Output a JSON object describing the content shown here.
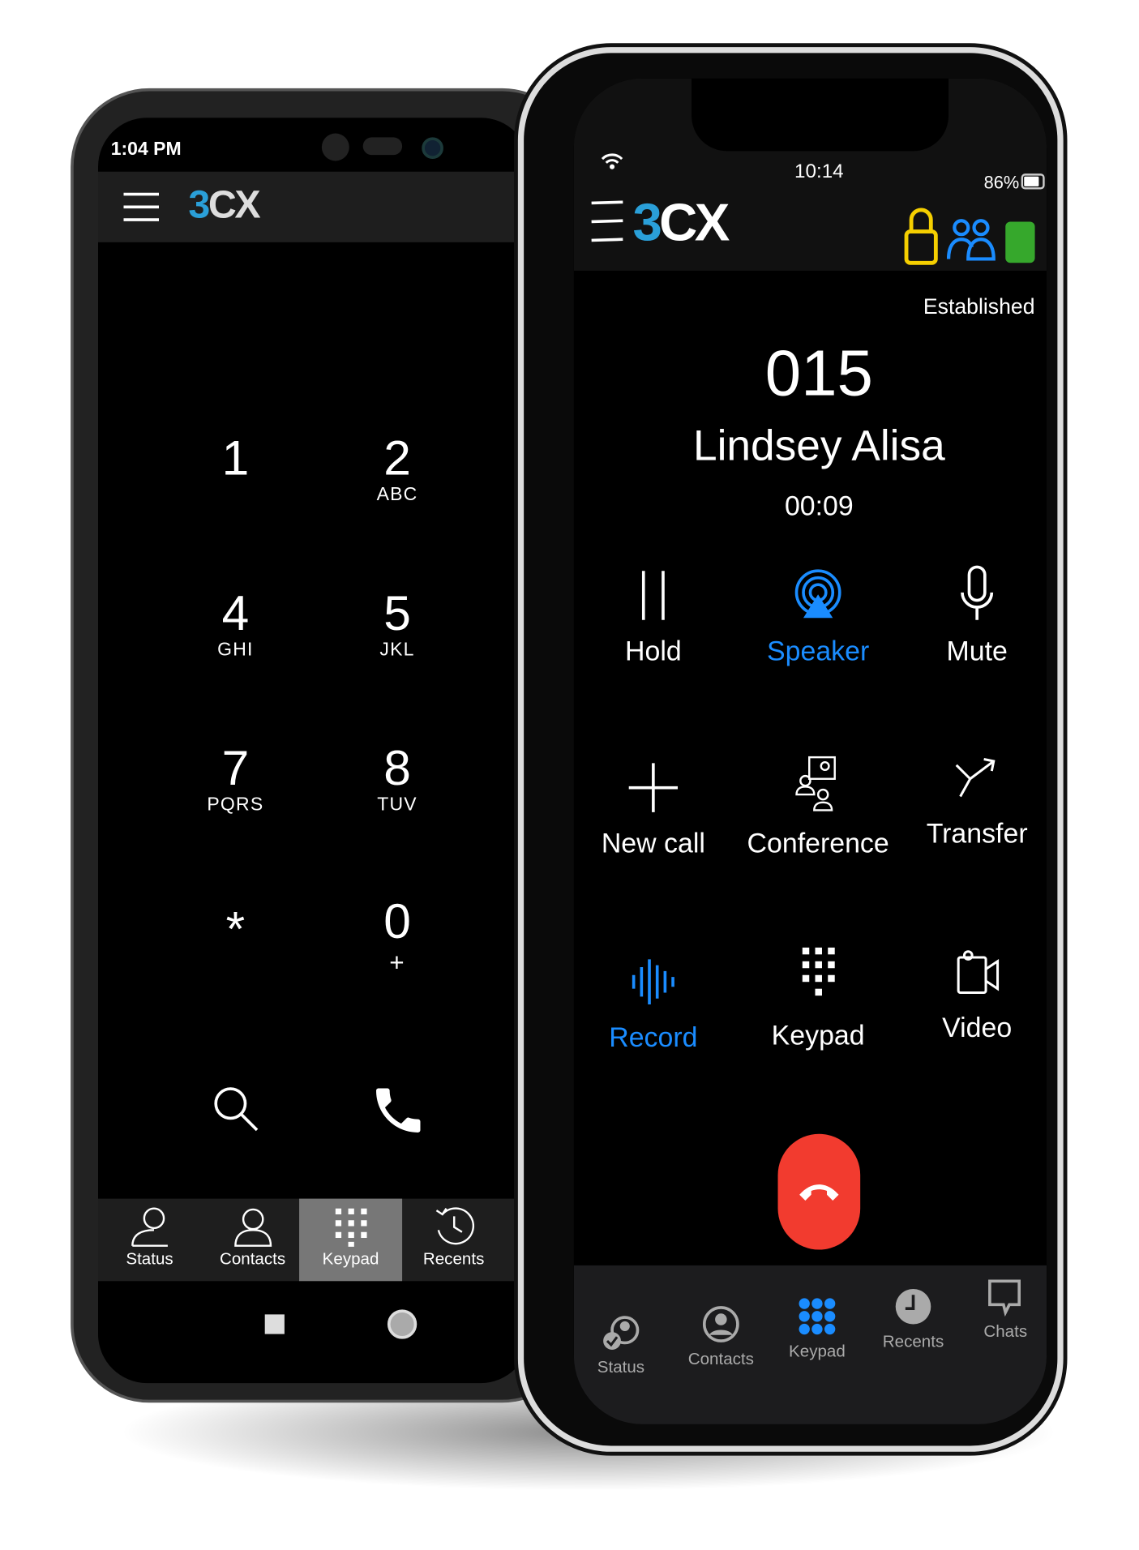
{
  "left_phone": {
    "status_time": "1:04 PM",
    "logo": "3CX",
    "keys": [
      {
        "digit": "1",
        "letters": ""
      },
      {
        "digit": "2",
        "letters": "ABC"
      },
      {
        "digit": "4",
        "letters": "GHI"
      },
      {
        "digit": "5",
        "letters": "JKL"
      },
      {
        "digit": "7",
        "letters": "PQRS"
      },
      {
        "digit": "8",
        "letters": "TUV"
      },
      {
        "digit": "*",
        "letters": ""
      },
      {
        "digit": "0",
        "letters": "+"
      }
    ],
    "nav": [
      {
        "label": "Status",
        "icon": "status-icon"
      },
      {
        "label": "Contacts",
        "icon": "contacts-icon"
      },
      {
        "label": "Keypad",
        "icon": "keypad-icon",
        "active": true
      },
      {
        "label": "Recents",
        "icon": "recents-icon"
      }
    ]
  },
  "right_phone": {
    "status_time": "10:14",
    "battery": "86%",
    "logo": "3CX",
    "call_state": "Established",
    "extension": "015",
    "caller_name": "Lindsey Alisa",
    "duration": "00:09",
    "actions": [
      {
        "label": "Hold",
        "icon": "hold-icon"
      },
      {
        "label": "Speaker",
        "icon": "speaker-icon",
        "active": true
      },
      {
        "label": "Mute",
        "icon": "mic-icon"
      },
      {
        "label": "New call",
        "icon": "plus-icon"
      },
      {
        "label": "Conference",
        "icon": "conference-icon"
      },
      {
        "label": "Transfer",
        "icon": "transfer-icon"
      },
      {
        "label": "Record",
        "icon": "record-icon",
        "active": true
      },
      {
        "label": "Keypad",
        "icon": "keypad-icon"
      },
      {
        "label": "Video",
        "icon": "video-icon"
      }
    ],
    "nav": [
      {
        "label": "Status"
      },
      {
        "label": "Contacts"
      },
      {
        "label": "Keypad",
        "active": true
      },
      {
        "label": "Recents"
      },
      {
        "label": "Chats"
      }
    ]
  },
  "colors": {
    "accent": "#1a8cff",
    "brand": "#2a9fd8",
    "lock": "#f5cf00",
    "presence": "#36a82c",
    "hangup": "#f23b2f"
  }
}
